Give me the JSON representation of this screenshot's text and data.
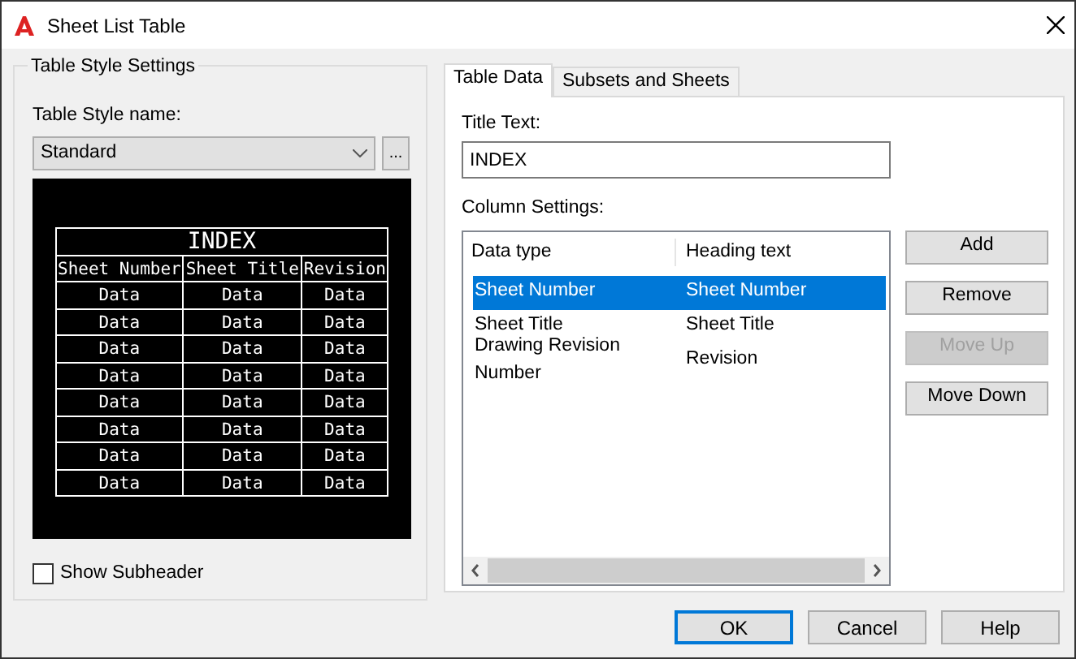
{
  "window": {
    "title": "Sheet List Table"
  },
  "table_style_settings": {
    "legend": "Table Style Settings",
    "style_name_label": "Table Style name:",
    "style_name_value": "Standard",
    "browse_button": "...",
    "preview": {
      "title": "INDEX",
      "columns": [
        "Sheet Number",
        "Sheet Title",
        "Revision"
      ],
      "rows": [
        [
          "Data",
          "Data",
          "Data"
        ],
        [
          "Data",
          "Data",
          "Data"
        ],
        [
          "Data",
          "Data",
          "Data"
        ],
        [
          "Data",
          "Data",
          "Data"
        ],
        [
          "Data",
          "Data",
          "Data"
        ],
        [
          "Data",
          "Data",
          "Data"
        ],
        [
          "Data",
          "Data",
          "Data"
        ],
        [
          "Data",
          "Data",
          "Data"
        ]
      ]
    },
    "show_subheader": {
      "label": "Show Subheader",
      "checked": false
    }
  },
  "tabs": [
    {
      "label": "Table Data",
      "selected": true
    },
    {
      "label": "Subsets and Sheets",
      "selected": false
    }
  ],
  "table_data": {
    "title_text_label": "Title Text:",
    "title_text_value": "INDEX",
    "column_settings_label": "Column Settings:",
    "columns": [
      "Data type",
      "Heading text"
    ],
    "rows": [
      {
        "data_type": "Sheet Number",
        "heading_text": "Sheet Number",
        "selected": true
      },
      {
        "data_type": "Sheet Title",
        "heading_text": "Sheet Title",
        "selected": false
      },
      {
        "data_type": "Drawing Revision Number",
        "heading_text": "Revision",
        "selected": false
      }
    ],
    "buttons": [
      {
        "label": "Add",
        "disabled": false
      },
      {
        "label": "Remove",
        "disabled": false
      },
      {
        "label": "Move Up",
        "disabled": true
      },
      {
        "label": "Move Down",
        "disabled": false
      }
    ]
  },
  "footer_buttons": [
    {
      "label": "OK",
      "default": true
    },
    {
      "label": "Cancel",
      "default": false
    },
    {
      "label": "Help",
      "default": false
    }
  ]
}
